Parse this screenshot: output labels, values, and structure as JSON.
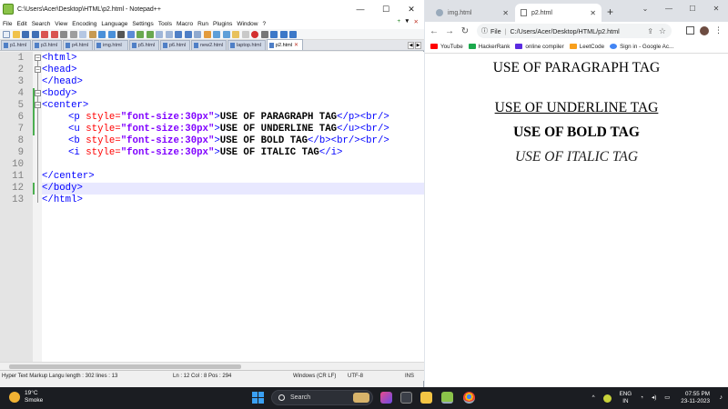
{
  "notepad": {
    "title": "C:\\Users\\Acer\\Desktop\\HTML\\p2.html - Notepad++",
    "menu": [
      "File",
      "Edit",
      "Search",
      "View",
      "Encoding",
      "Language",
      "Settings",
      "Tools",
      "Macro",
      "Run",
      "Plugins",
      "Window",
      "?"
    ],
    "menu_right": [
      "+",
      "▼",
      "✕"
    ],
    "tabs": [
      {
        "label": "p1.html",
        "active": false
      },
      {
        "label": "p3.html",
        "active": false
      },
      {
        "label": "p4.html",
        "active": false
      },
      {
        "label": "img.html",
        "active": false
      },
      {
        "label": "p5.html",
        "active": false
      },
      {
        "label": "p6.html",
        "active": false
      },
      {
        "label": "new2.html",
        "active": false
      },
      {
        "label": "laptop.html",
        "active": false
      },
      {
        "label": "p2.html",
        "active": true
      }
    ],
    "line_numbers": [
      "1",
      "2",
      "3",
      "4",
      "5",
      "6",
      "7",
      "8",
      "9",
      "10",
      "11",
      "12",
      "13"
    ],
    "code": {
      "l1": "<html>",
      "l2": "<head>",
      "l3": "</head>",
      "l4": "<body>",
      "l5": "<center>",
      "p_open": "<p",
      "style_attr": " style=",
      "style_val": "\"font-size:30px\"",
      "gt": ">",
      "p_text": "USE OF PARAGRAPH TAG",
      "p_close": "</p><br/>",
      "u_open": "<u",
      "u_text": "USE OF UNDERLINE TAG",
      "u_close": "</u><br/>",
      "b_open": "<b",
      "b_text": "USE OF BOLD TAG",
      "b_close": "</b><br/><br/>",
      "i_open": "<i",
      "i_text": "USE OF ITALIC TAG",
      "i_close": "</i>",
      "l11": "</center>",
      "l12": "</body>",
      "l13": "</html>"
    },
    "current_line": 12,
    "status": {
      "filetype": "Hyper Text Markup Langu length : 302    lines : 13",
      "position": "Ln : 12    Col : 8    Pos : 294",
      "eol": "Windows (CR LF)",
      "encoding": "UTF-8",
      "mode": "INS"
    }
  },
  "chrome": {
    "tabs": [
      {
        "label": "img.html",
        "active": false
      },
      {
        "label": "p2.html",
        "active": true
      }
    ],
    "new_tab": "+",
    "address": {
      "security": "File",
      "url": "C:/Users/Acer/Desktop/HTML/p2.html"
    },
    "bookmarks": [
      {
        "label": "YouTube",
        "color": "#ff0000"
      },
      {
        "label": "HackerRank",
        "color": "#1ba94c"
      },
      {
        "label": "online compiler",
        "color": "#5b2be0"
      },
      {
        "label": "LeetCode",
        "color": "#f89f1b"
      },
      {
        "label": "Sign in - Google Ac...",
        "color": "#4285f4"
      }
    ],
    "page": {
      "paragraph": "USE OF PARAGRAPH TAG",
      "underline": "USE OF UNDERLINE TAG",
      "bold": "USE OF BOLD TAG",
      "italic": "USE OF ITALIC TAG"
    }
  },
  "taskbar": {
    "weather_temp": "19°C",
    "weather_desc": "Smoke",
    "search_placeholder": "Search",
    "language_line1": "ENG",
    "language_line2": "IN",
    "time": "07:55 PM",
    "date": "23-11-2023"
  }
}
